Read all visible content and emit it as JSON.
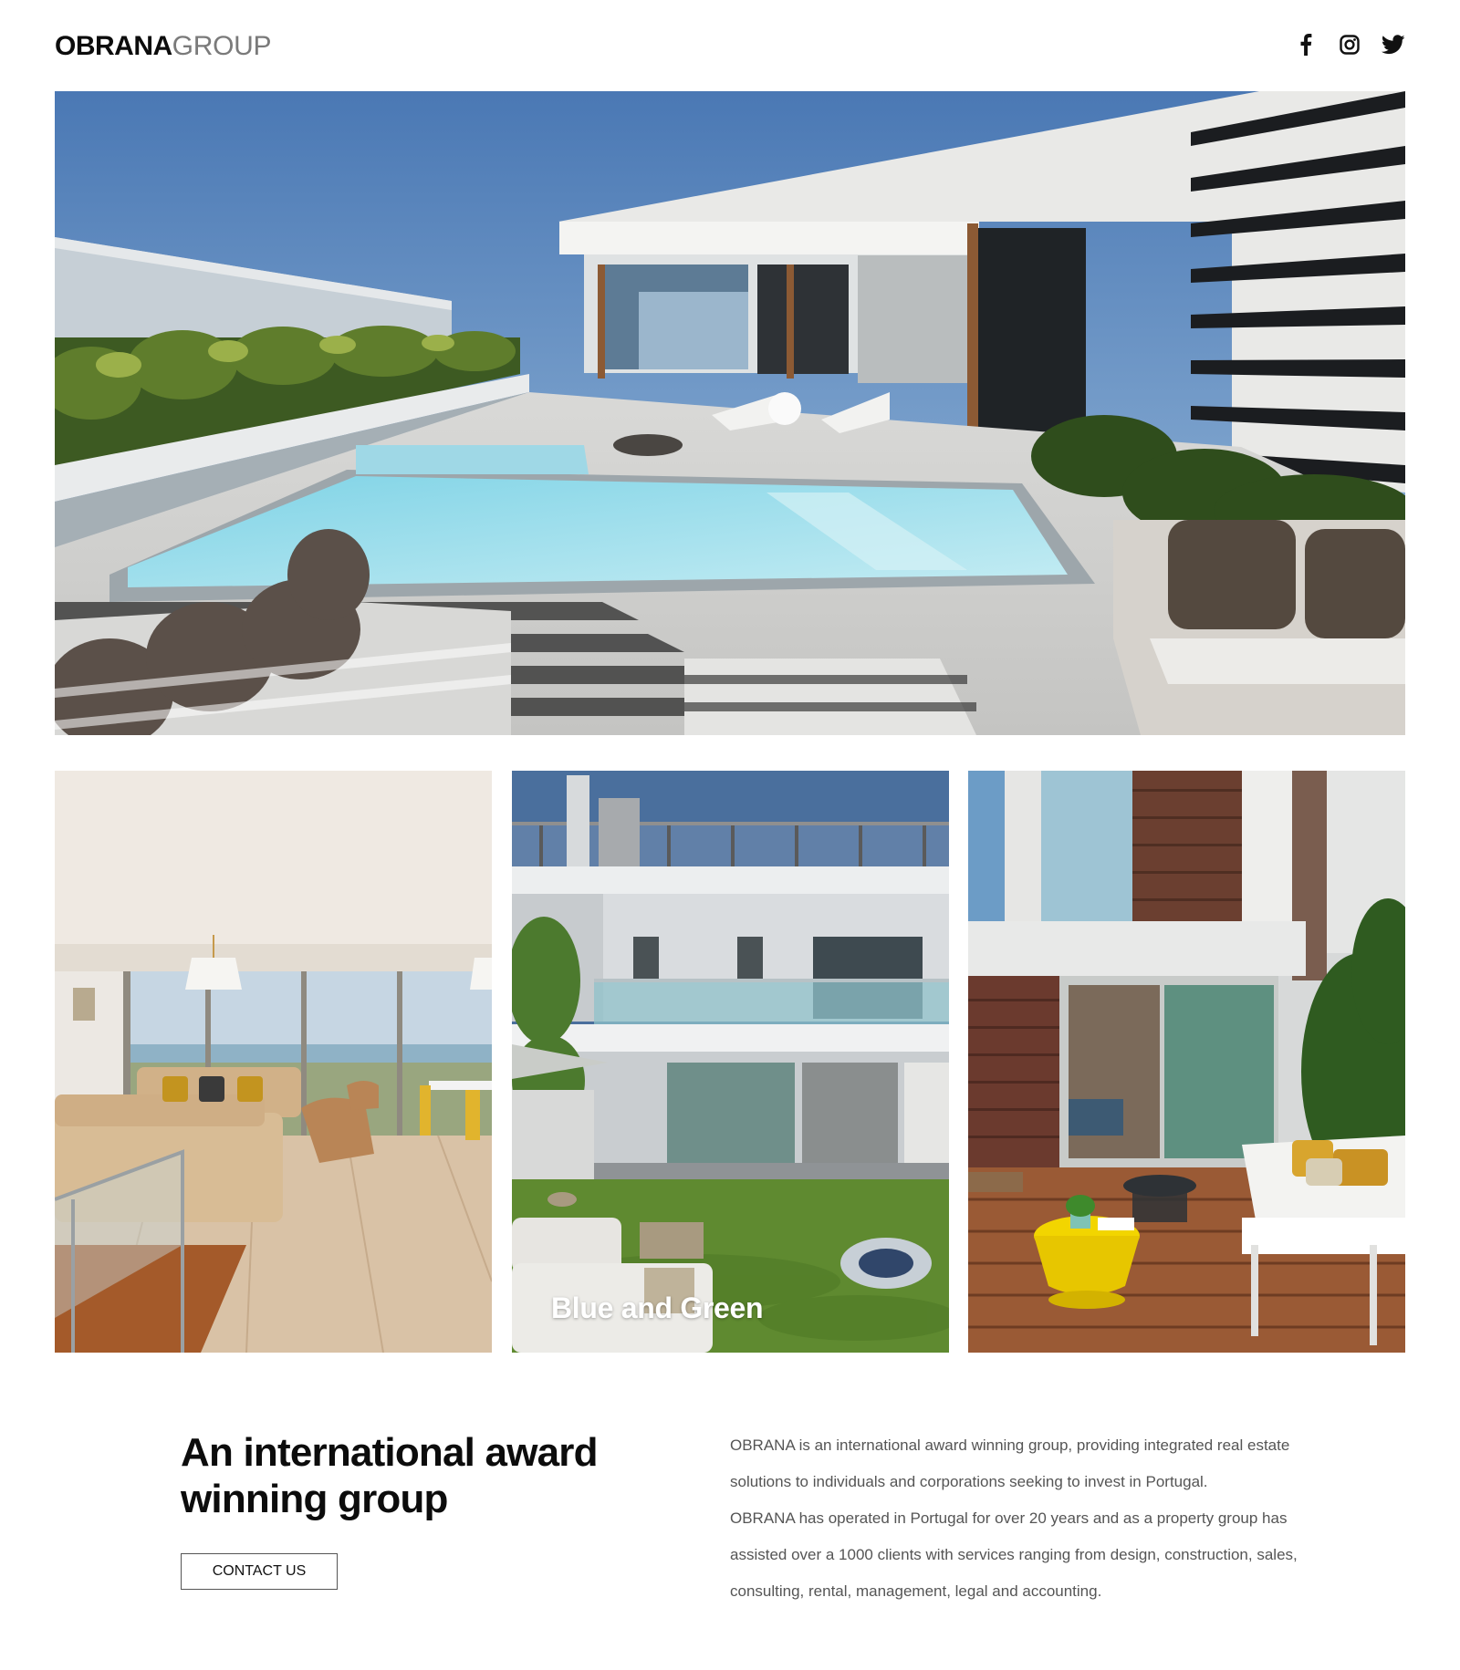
{
  "brand": {
    "name_bold": "OBRANA",
    "name_light": "GROUP"
  },
  "social": [
    {
      "icon": "facebook-icon"
    },
    {
      "icon": "instagram-icon"
    },
    {
      "icon": "twitter-icon"
    }
  ],
  "hero": {
    "image": "rooftop-pool-terrace"
  },
  "gallery": [
    {
      "image": "living-room-sea-view",
      "caption": ""
    },
    {
      "image": "modern-house-garden",
      "caption": "Blue and Green"
    },
    {
      "image": "wooden-terrace-patio",
      "caption": ""
    }
  ],
  "about": {
    "title": "An international award winning group",
    "cta_label": "CONTACT US",
    "paragraph_1": "OBRANA is an international award winning group, providing integrated real estate solutions to individuals and corporations seeking to invest in Portugal.",
    "paragraph_2": "OBRANA has operated in Portugal for over 20 years and as a property group has assisted over a 1000 clients with services ranging from design, construction, sales, consulting, rental, management, legal and accounting."
  }
}
